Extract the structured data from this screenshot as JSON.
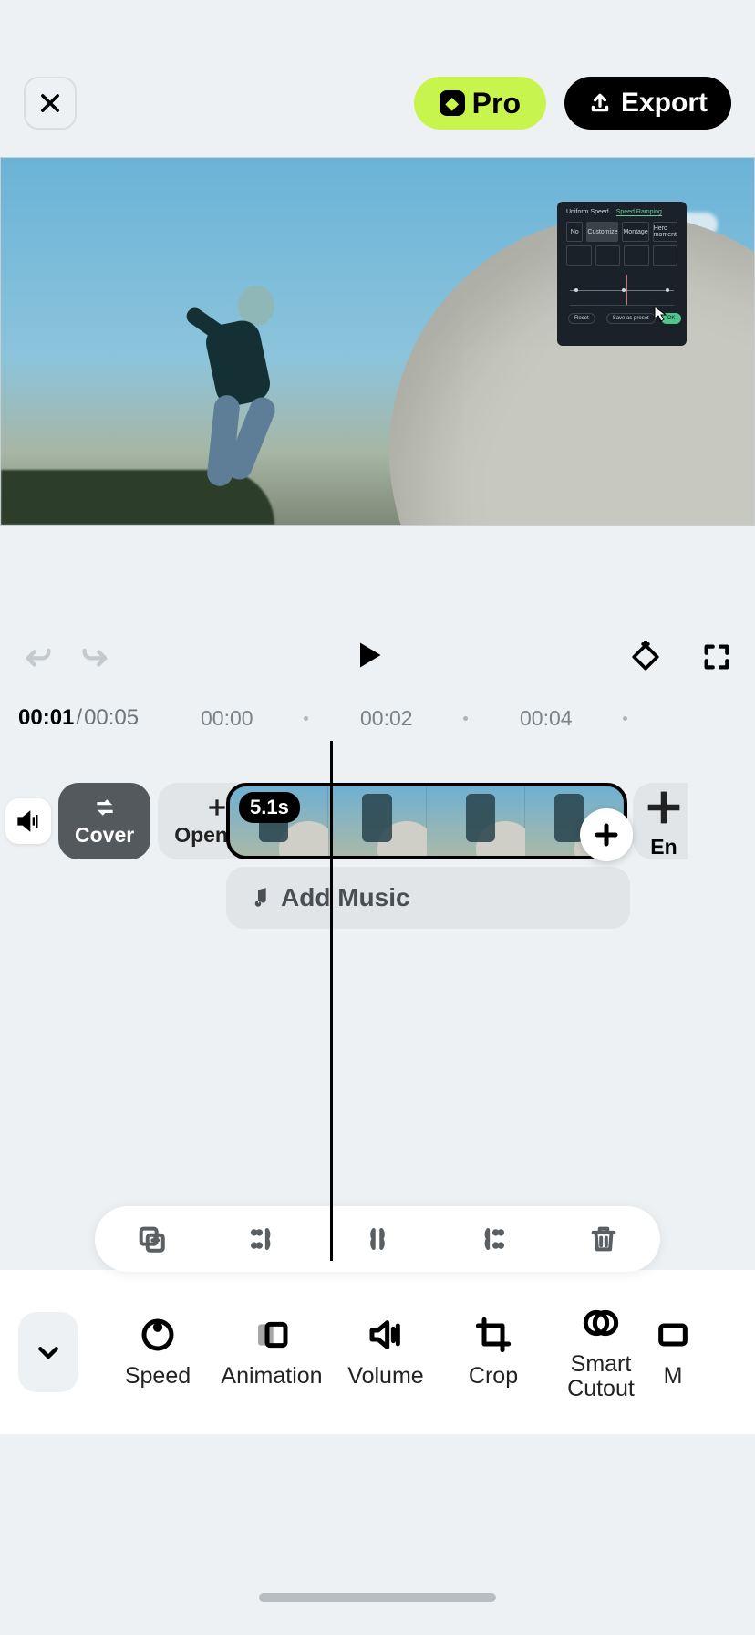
{
  "header": {
    "pro_label": "Pro",
    "export_label": "Export"
  },
  "pip": {
    "tab_uniform": "Uniform Speed",
    "tab_ramp": "Speed Ramping",
    "presets": [
      "No",
      "Customize",
      "Montage",
      "Hero moment"
    ],
    "reset": "Reset",
    "save_preset": "Save as preset",
    "ok": "OK"
  },
  "time": {
    "current": "00:01",
    "total": "00:05",
    "marks": [
      "00:00",
      "00:02",
      "00:04"
    ]
  },
  "timeline": {
    "cover_label": "Cover",
    "opening_label": "Opening",
    "ending_label": "En",
    "clip_duration": "5.1s",
    "add_music": "Add Music"
  },
  "tools": {
    "speed": "Speed",
    "animation": "Animation",
    "volume": "Volume",
    "crop": "Crop",
    "smart_cutout": "Smart\nCutout",
    "more": "M"
  }
}
